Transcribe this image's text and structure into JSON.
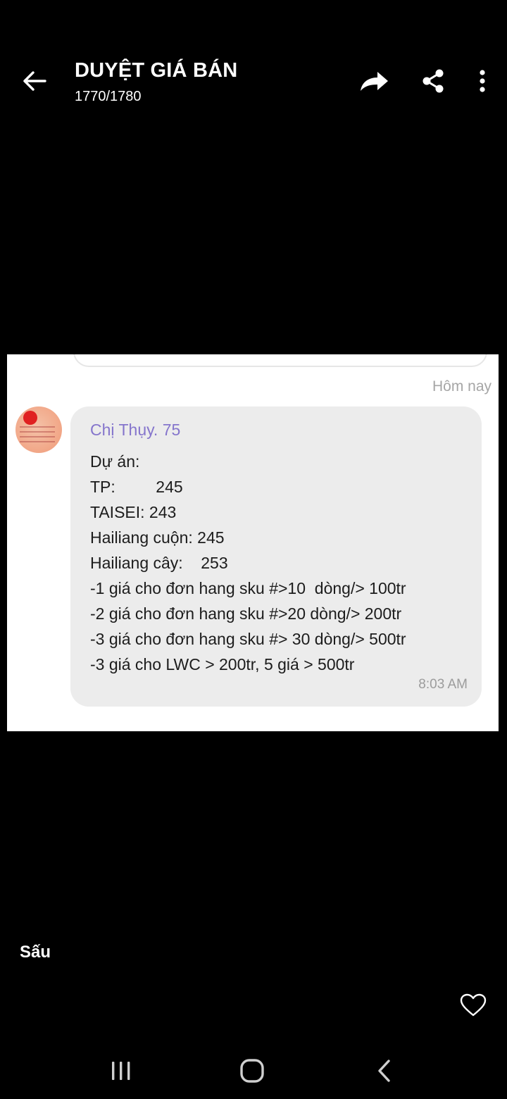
{
  "header": {
    "title": "DUYỆT GIÁ BÁN",
    "subtitle": "1770/1780",
    "icons": [
      "back-arrow-icon",
      "forward-icon",
      "share-icon",
      "more-vertical-icon"
    ]
  },
  "chat": {
    "date_label": "Hôm nay",
    "sender": "Chị Thụy. 75",
    "lines": [
      "Dự án:",
      "TP:         245",
      "TAISEI: 243",
      "Hailiang cuộn: 245",
      "Hailiang cây:    253",
      "-1 giá cho đơn hang sku #>10  dòng/> 100tr",
      "-2 giá cho đơn hang sku #>20 dòng/> 200tr",
      "-3 giá cho đơn hang sku #> 30 dòng/> 500tr",
      "-3 giá cho LWC > 200tr, 5 giá > 500tr"
    ],
    "time": "8:03 AM"
  },
  "caption": "Sấu",
  "colors": {
    "background": "#000000",
    "sender_name": "#8575cc",
    "bubble": "#ececec"
  }
}
